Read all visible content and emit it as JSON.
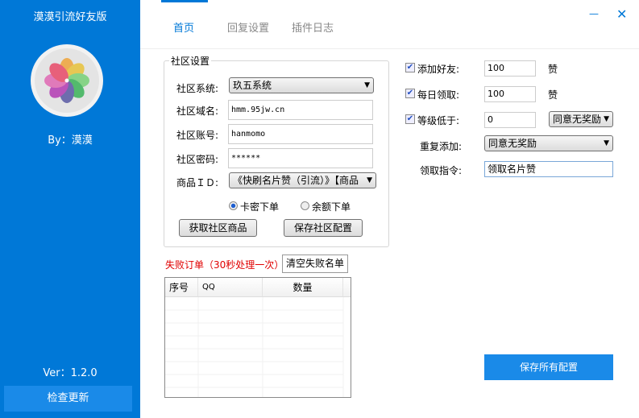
{
  "app": {
    "title": "漠漠引流好友版",
    "author": "By：漠漠",
    "version": "Ver：1.2.0",
    "check_update": "检查更新"
  },
  "tabs": [
    {
      "label": "首页",
      "active": true
    },
    {
      "label": "回复设置"
    },
    {
      "label": "插件日志"
    }
  ],
  "window": {
    "minimize": "—",
    "close": "✕"
  },
  "community": {
    "group_label": "社区设置",
    "system_label": "社区系统:",
    "system_value": "玖五系统",
    "domain_label": "社区域名:",
    "domain_value": "hmm.95jw.cn",
    "account_label": "社区账号:",
    "account_value": "hanmomo",
    "password_label": "社区密码:",
    "password_value": "******",
    "product_label": "商品ＩＤ:",
    "product_value": "《快刷名片赞（引流）》【商品",
    "radio_card": "卡密下单",
    "radio_balance": "余额下单",
    "radio_selected": "卡密下单",
    "fetch_button": "获取社区商品",
    "save_button": "保存社区配置"
  },
  "options": {
    "add_friend": {
      "label": "添加好友:",
      "checked": true,
      "value": "100",
      "unit": "赞"
    },
    "daily": {
      "label": "每日领取:",
      "checked": true,
      "value": "100",
      "unit": "赞"
    },
    "level": {
      "label": "等级低于:",
      "checked": true,
      "value": "0",
      "select": "同意无奖励"
    },
    "repeat": {
      "label": "重复添加:",
      "select": "同意无奖励"
    },
    "command": {
      "label": "领取指令:",
      "value": "领取名片赞"
    }
  },
  "failed": {
    "title": "失败订单（30秒处理一次）",
    "clear_button": "清空失败名单",
    "columns": [
      "序号",
      "QQ",
      "数量"
    ],
    "rows": []
  },
  "save_all": "保存所有配置",
  "colors": {
    "accent": "#0078d7",
    "button": "#1a8ae8",
    "error": "#e00000"
  }
}
